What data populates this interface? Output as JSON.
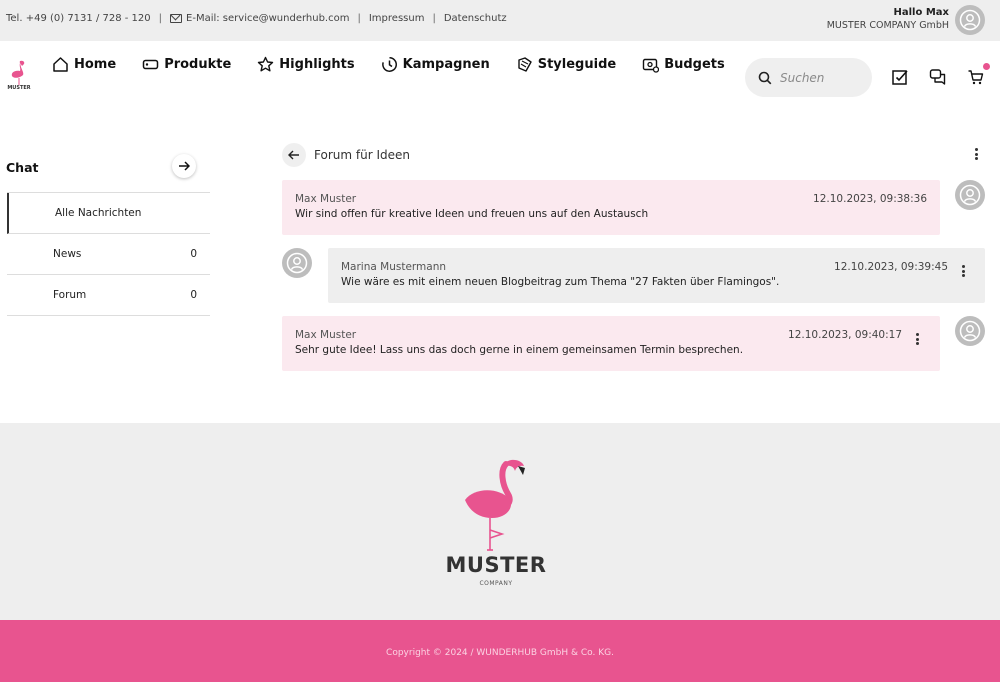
{
  "topbar": {
    "phone": "Tel. +49 (0) 7131 / 728 - 120",
    "email": "E-Mail: service@wunderhub.com",
    "imprint": "Impressum",
    "privacy": "Datenschutz",
    "separator": "|",
    "user_greeting": "Hallo Max",
    "user_company": "MUSTER COMPANY GmbH"
  },
  "logo": {
    "name": "MUSTER",
    "sub": "COMPANY"
  },
  "nav": {
    "items": [
      {
        "label": "Home",
        "icon": "home-icon"
      },
      {
        "label": "Produkte",
        "icon": "tag-icon"
      },
      {
        "label": "Highlights",
        "icon": "star-icon"
      },
      {
        "label": "Kampagnen",
        "icon": "clock-icon"
      },
      {
        "label": "Styleguide",
        "icon": "palette-icon"
      },
      {
        "label": "Budgets",
        "icon": "budget-icon"
      }
    ],
    "search_placeholder": "Suchen"
  },
  "sidebar": {
    "title": "Chat",
    "items": [
      {
        "label": "Alle Nachrichten",
        "count": ""
      },
      {
        "label": "News",
        "count": "0"
      },
      {
        "label": "Forum",
        "count": "0"
      }
    ]
  },
  "thread": {
    "title": "Forum für Ideen",
    "messages": [
      {
        "author": "Max Muster",
        "time": "12.10.2023, 09:38:36",
        "text": "Wir sind offen für kreative Ideen und freuen uns auf den Austausch"
      },
      {
        "author": "Marina Mustermann",
        "time": "12.10.2023, 09:39:45",
        "text": "Wie wäre es mit einem neuen Blogbeitrag zum Thema \"27 Fakten über Flamingos\"."
      },
      {
        "author": "Max Muster",
        "time": "12.10.2023, 09:40:17",
        "text": "Sehr gute Idee! Lass uns das doch gerne in einem gemeinsamen Termin besprechen."
      }
    ]
  },
  "footer": {
    "brand_name": "MUSTER",
    "brand_sub": "COMPANY",
    "copyright": "Copyright © 2024 / WUNDERHUB GmbH & Co. KG."
  },
  "colors": {
    "accent": "#e8548f",
    "own_message_bg": "#fbe9ef",
    "other_message_bg": "#eeeeee"
  }
}
